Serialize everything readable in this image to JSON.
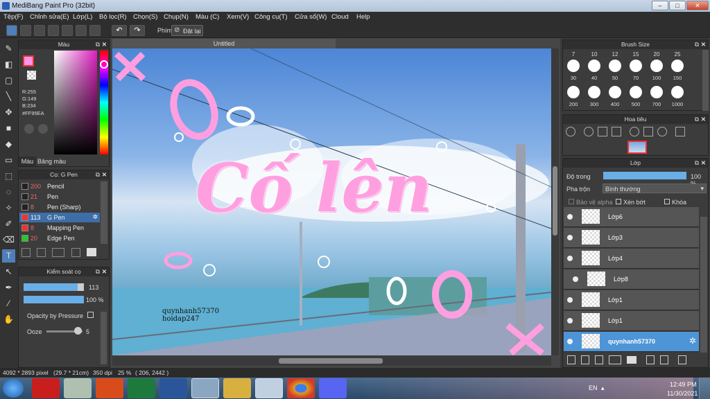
{
  "app": {
    "title": "MediBang Paint Pro (32bit)"
  },
  "menu": [
    "Tệp(F)",
    "Chỉnh sửa(E)",
    "Lớp(L)",
    "Bộ lọc(R)",
    "Chọn(S)",
    "Chụp(N)",
    "Màu (C)",
    "Xem(V)",
    "Công cụ(T)",
    "Cửa sổ(W)",
    "Cloud",
    "Help"
  ],
  "toolbar": {
    "phim": "Phím",
    "reset": "Đặt lại"
  },
  "color_panel": {
    "title": "Màu",
    "rgb": "R:255\nG:149\nB:234",
    "hex": "#FF95EA",
    "tab1": "Màu",
    "tab2": "Bảng màu",
    "fg": "#FF95EA"
  },
  "brush_panel": {
    "title": "Cọ: G Pen",
    "items": [
      {
        "size": "200",
        "name": "Pencil",
        "color": "#222"
      },
      {
        "size": "21",
        "name": "Pen",
        "color": "#222"
      },
      {
        "size": "8",
        "name": "Pen (Sharp)",
        "color": "#222"
      },
      {
        "size": "113",
        "name": "G Pen",
        "color": "#e33",
        "active": true
      },
      {
        "size": "8",
        "name": "Mapping Pen",
        "color": "#e33"
      },
      {
        "size": "20",
        "name": "Edge Pen",
        "color": "#2c2"
      }
    ]
  },
  "brush_control": {
    "title": "Kiểm soát cọ",
    "size": "113",
    "opacity": "100 %",
    "size_pct": 0.9,
    "opacity_pct": 1.0,
    "opacity_pressure": "Opacity by Pressure",
    "ooze": "Ooze",
    "ooze_val": "5"
  },
  "canvas": {
    "tab": "Untitled",
    "title_text": "Cố lên",
    "watermark1": "quynhanh57370",
    "watermark2": "hoidap247"
  },
  "brush_size": {
    "title": "Brush Size",
    "top": [
      "7",
      "10",
      "12",
      "15",
      "20",
      "25"
    ],
    "row1": [
      "30",
      "40",
      "50",
      "70",
      "100",
      "150"
    ],
    "row2": [
      "200",
      "300",
      "400",
      "500",
      "700",
      "1000"
    ]
  },
  "navigator": {
    "title": "Hoa tiêu"
  },
  "layer_panel": {
    "title": "Lớp",
    "opacity_label": "Độ trong",
    "opacity_val": "100 %",
    "blend_label": "Pha trộn",
    "blend_val": "Bình thường",
    "protect": "Bảo vệ alpha",
    "clip": "Xén bớt",
    "lock": "Khóa",
    "layers": [
      {
        "name": "Lớp6"
      },
      {
        "name": "Lớp3"
      },
      {
        "name": "Lớp4"
      },
      {
        "name": "Lớp8",
        "indent": true
      },
      {
        "name": "Lớp1"
      },
      {
        "name": "Lớp1"
      },
      {
        "name": "quynhanh57370",
        "active": true
      }
    ]
  },
  "status": {
    "size": "4092 * 2893 pixel",
    "cm": "(29.7 * 21cm)",
    "dpi": "350 dpi",
    "zoom": "25 %",
    "coord": "( 206, 2442 )"
  },
  "taskbar": {
    "lang": "EN",
    "time": "12:49 PM",
    "date": "11/30/2021"
  }
}
